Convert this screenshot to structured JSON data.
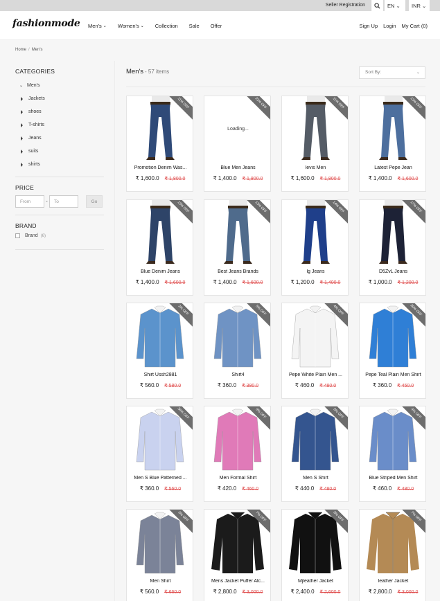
{
  "topbar": {
    "seller_registration": "Seller Registration",
    "language": "EN",
    "currency": "INR"
  },
  "header": {
    "logo": "fashionmode",
    "nav": [
      "Men's",
      "Women's",
      "Collection",
      "Sale",
      "Offer"
    ],
    "account": {
      "signup": "Sign Up",
      "login": "Login",
      "cart": "My Cart (0)"
    }
  },
  "breadcrumb": {
    "home": "Home",
    "current": "Men's"
  },
  "sidebar": {
    "categories_title": "CATEGORIES",
    "root_category": "Men's",
    "categories": [
      "Jackets",
      "shoes",
      "T-shirts",
      "Jeans",
      "suits",
      "shirts"
    ],
    "price_title": "PRICE",
    "price_from_placeholder": "From",
    "price_to_placeholder": "To",
    "price_go": "Go",
    "brand_title": "BRAND",
    "brand_label": "Brand",
    "brand_count": "(6)"
  },
  "main": {
    "title": "Men's",
    "count": "- 57 items",
    "sort_placeholder": "Sort By:"
  },
  "products": [
    {
      "name": "Promotion Denim Was...",
      "price": "₹ 1,600.0",
      "old_price": "₹ 1,800.0",
      "discount": "11% OFF",
      "kind": "jeans",
      "color": "#2f4a78"
    },
    {
      "name": "Blue Men Jeans",
      "price": "₹ 1,400.0",
      "old_price": "₹ 1,800.0",
      "discount": "22% OFF",
      "kind": "loading",
      "loading": "Loading..."
    },
    {
      "name": "levis Men",
      "price": "₹ 1,600.0",
      "old_price": "₹ 1,800.0",
      "discount": "11% OFF",
      "kind": "jeans",
      "color": "#555c66"
    },
    {
      "name": "Latest Pepe Jean",
      "price": "₹ 1,400.0",
      "old_price": "₹ 1,600.0",
      "discount": "13% OFF",
      "kind": "jeans",
      "color": "#4d6f9e"
    },
    {
      "name": "Blue Denim Jeans",
      "price": "₹ 1,400.0",
      "old_price": "₹ 1,600.0",
      "discount": "13% OFF",
      "kind": "jeans",
      "color": "#2e4468"
    },
    {
      "name": "Best Jeans Brands",
      "price": "₹ 1,400.0",
      "old_price": "₹ 1,600.0",
      "discount": "13% OFF",
      "kind": "jeans",
      "color": "#4f6b8c"
    },
    {
      "name": "lg Jeans",
      "price": "₹ 1,200.0",
      "old_price": "₹ 1,400.0",
      "discount": "14% OFF",
      "kind": "jeans",
      "color": "#1f3f8a"
    },
    {
      "name": "D5ZvL Jeans",
      "price": "₹ 1,000.0",
      "old_price": "₹ 1,200.0",
      "discount": "17% OFF",
      "kind": "jeans",
      "color": "#1d2236"
    },
    {
      "name": "Shirt Ussh2881",
      "price": "₹ 560.0",
      "old_price": "₹ 580.0",
      "discount": "3% OFF",
      "kind": "shirt",
      "color": "#5b93cc"
    },
    {
      "name": "Shirt4",
      "price": "₹ 360.0",
      "old_price": "₹ 380.0",
      "discount": "5% OFF",
      "kind": "shirt",
      "color": "#6f93c4"
    },
    {
      "name": "Pepe White Plain Men ...",
      "price": "₹ 460.0",
      "old_price": "₹ 480.0",
      "discount": "4% OFF",
      "kind": "shirt",
      "color": "#f4f4f4"
    },
    {
      "name": "Pepe Teal Plain Men Shirt",
      "price": "₹ 360.0",
      "old_price": "₹ 450.0",
      "discount": "20% OFF",
      "kind": "shirt",
      "color": "#2f7fd6"
    },
    {
      "name": "Men S Blue Patterned ...",
      "price": "₹ 360.0",
      "old_price": "₹ 560.0",
      "discount": "36% OFF",
      "kind": "shirt",
      "color": "#c9d2ef"
    },
    {
      "name": "Men Formal Shirt",
      "price": "₹ 420.0",
      "old_price": "₹ 460.0",
      "discount": "9% OFF",
      "kind": "shirt",
      "color": "#e07ab8"
    },
    {
      "name": "Men S Shirt",
      "price": "₹ 440.0",
      "old_price": "₹ 480.0",
      "discount": "8% OFF",
      "kind": "shirt",
      "color": "#34558f"
    },
    {
      "name": "Blue Striped Men Shirt",
      "price": "₹ 460.0",
      "old_price": "₹ 480.0",
      "discount": "4% OFF",
      "kind": "shirt",
      "color": "#6a8dc9"
    },
    {
      "name": "Men Shirt",
      "price": "₹ 560.0",
      "old_price": "₹ 660.0",
      "discount": "3% OFF",
      "kind": "shirt",
      "color": "#7b8398"
    },
    {
      "name": "Mens Jacket Puffer Alc...",
      "price": "₹ 2,800.0",
      "old_price": "₹ 3,000.0",
      "discount": "7% OFF",
      "kind": "jacket",
      "color": "#1b1b1b"
    },
    {
      "name": "Mjleather Jacket",
      "price": "₹ 2,400.0",
      "old_price": "₹ 2,600.0",
      "discount": "8% OFF",
      "kind": "jacket",
      "color": "#111111"
    },
    {
      "name": "leather Jacket",
      "price": "₹ 2,800.0",
      "old_price": "₹ 3,000.0",
      "discount": "7% OFF",
      "kind": "jacket",
      "color": "#b48a55"
    }
  ]
}
